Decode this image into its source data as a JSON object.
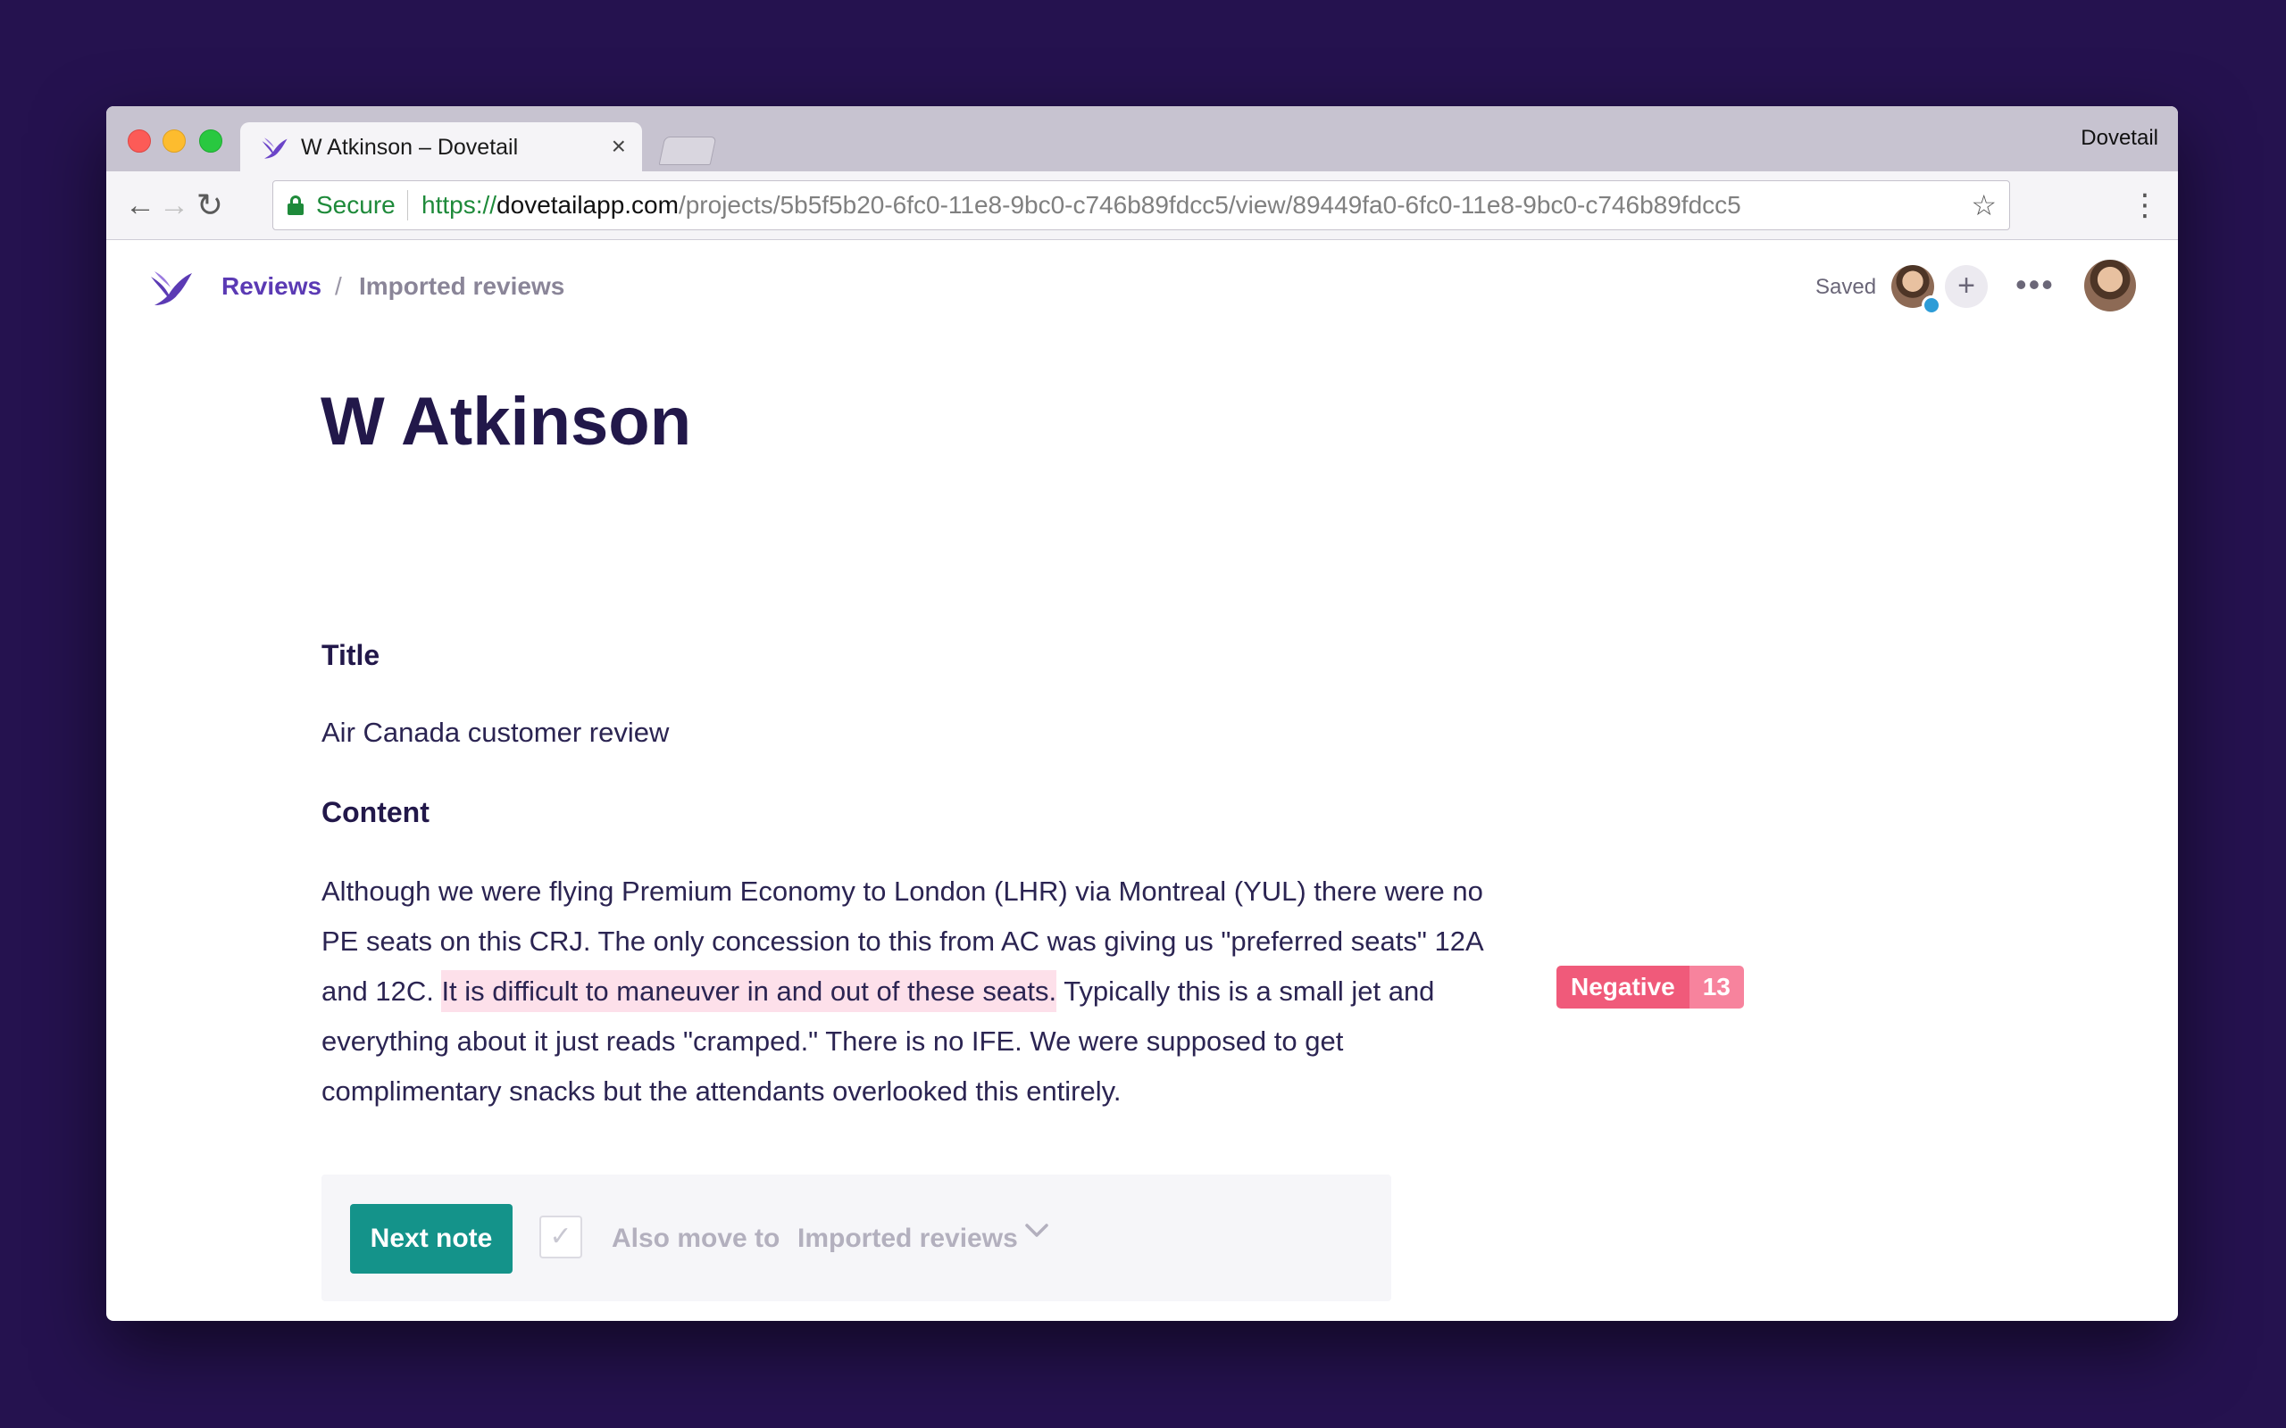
{
  "browser": {
    "tab_title": "W Atkinson – Dovetail",
    "tab_close": "×",
    "profile_name": "Dovetail",
    "secure_label": "Secure",
    "url_scheme": "https://",
    "url_host": "dovetailapp.com",
    "url_path": "/projects/5b5f5b20-6fc0-11e8-9bc0-c746b89fdcc5/view/89449fa0-6fc0-11e8-9bc0-c746b89fdcc5",
    "back_glyph": "←",
    "forward_glyph": "→",
    "reload_glyph": "↻",
    "star_glyph": "☆",
    "menu_glyph": "⋮"
  },
  "header": {
    "breadcrumb_root": "Reviews",
    "breadcrumb_separator": "/",
    "breadcrumb_current": "Imported reviews",
    "status": "Saved",
    "add_glyph": "+",
    "more_glyph": "•••"
  },
  "note": {
    "title": "W Atkinson",
    "title_field_label": "Title",
    "title_field_value": "Air Canada customer review",
    "content_field_label": "Content",
    "content_before": "Although we were flying Premium Economy to London (LHR) via Montreal (YUL) there were no PE seats on this CRJ. The only concession to this from AC was giving us \"preferred seats\" 12A and 12C. ",
    "content_highlight": "It is difficult to maneuver in and out of these seats.",
    "content_after": " Typically this is a small jet and everything about it just reads \"cramped.\" There is no IFE. We were supposed to get complimentary snacks but the attendants overlooked this entirely."
  },
  "tag": {
    "name": "Negative",
    "count": "13",
    "color": "#f05a7a"
  },
  "footer": {
    "next_button": "Next note",
    "checkbox_glyph": "✓",
    "also_move_label": "Also move to",
    "destination": "Imported reviews"
  },
  "colors": {
    "background": "#25124f",
    "accent": "#5b3ab4",
    "primary_button": "#14938a",
    "highlight": "#fde0ea"
  }
}
